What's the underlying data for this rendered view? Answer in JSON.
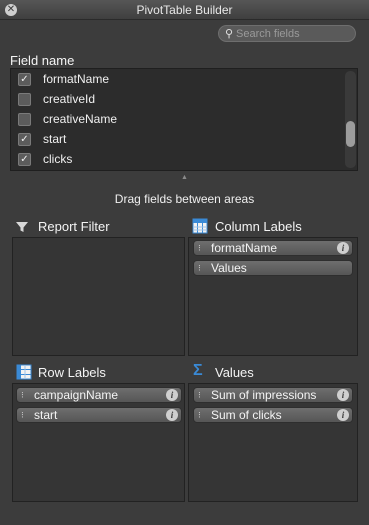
{
  "window": {
    "title": "PivotTable Builder"
  },
  "search": {
    "placeholder": "Search fields"
  },
  "field_list": {
    "header": "Field name",
    "items": [
      {
        "label": "formatName",
        "checked": true
      },
      {
        "label": "creativeId",
        "checked": false
      },
      {
        "label": "creativeName",
        "checked": false
      },
      {
        "label": "start",
        "checked": true
      },
      {
        "label": "clicks",
        "checked": true
      }
    ]
  },
  "drag_hint": "Drag fields between areas",
  "areas": {
    "report_filter": {
      "title": "Report Filter",
      "icon": "funnel-icon",
      "items": []
    },
    "column_labels": {
      "title": "Column Labels",
      "icon": "table-columns-icon",
      "items": [
        "formatName",
        "Values"
      ]
    },
    "row_labels": {
      "title": "Row Labels",
      "icon": "table-rows-icon",
      "items": [
        "campaignName",
        "start"
      ]
    },
    "values": {
      "title": "Values",
      "icon": "sigma-icon",
      "items": [
        "Sum of impressions",
        "Sum of clicks"
      ]
    }
  },
  "colors": {
    "background": "#3c3c3c",
    "accent_blue": "#3a8ad6"
  }
}
